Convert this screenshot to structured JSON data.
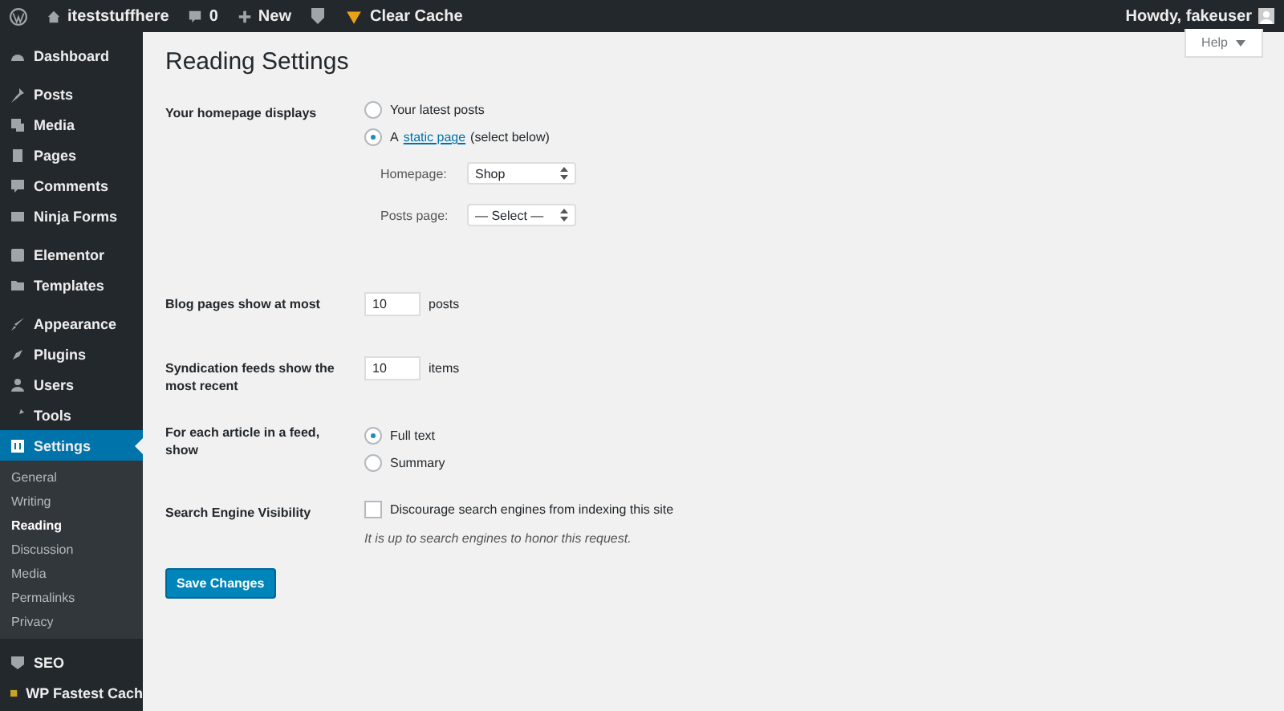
{
  "admin_bar": {
    "site": "iteststuffhere",
    "comments": "0",
    "new": "New",
    "cache": "Clear Cache",
    "greeting": "Howdy, fakeuser"
  },
  "sidebar": {
    "groups": [
      [
        {
          "label": "Dashboard",
          "selected": false
        }
      ],
      [
        {
          "label": "Posts",
          "selected": false
        },
        {
          "label": "Media",
          "selected": false
        },
        {
          "label": "Pages",
          "selected": false
        },
        {
          "label": "Comments",
          "selected": false
        },
        {
          "label": "Ninja Forms",
          "selected": false
        }
      ],
      [
        {
          "label": "Elementor",
          "selected": false
        },
        {
          "label": "Templates",
          "selected": false
        }
      ],
      [
        {
          "label": "Appearance",
          "selected": false
        },
        {
          "label": "Plugins",
          "selected": false
        },
        {
          "label": "Users",
          "selected": false
        },
        {
          "label": "Tools",
          "selected": false
        },
        {
          "label": "Settings",
          "selected": true,
          "children": [
            {
              "label": "General",
              "selected": false
            },
            {
              "label": "Writing",
              "selected": false
            },
            {
              "label": "Reading",
              "selected": true
            },
            {
              "label": "Discussion",
              "selected": false
            },
            {
              "label": "Media",
              "selected": false
            },
            {
              "label": "Permalinks",
              "selected": false
            },
            {
              "label": "Privacy",
              "selected": false
            }
          ]
        }
      ],
      [
        {
          "label": "SEO",
          "selected": false
        },
        {
          "label": "WP Fastest Cach",
          "selected": false
        }
      ]
    ]
  },
  "help": "Help",
  "title": "Reading Settings",
  "homepage": {
    "label": "Your homepage displays",
    "options": [
      {
        "text": "Your latest posts",
        "selected": false
      },
      {
        "text": "A",
        "link": "static page",
        "after": "(select below)",
        "selected": true
      }
    ],
    "selects": [
      {
        "label": "Homepage:",
        "value": "Shop"
      },
      {
        "label": "Posts page:",
        "value": "— Select —"
      }
    ]
  },
  "blog_pages": {
    "label": "Blog pages show at most",
    "value": "10",
    "unit": "posts"
  },
  "feeds": {
    "label": "Syndication feeds show the most recent",
    "value": "10",
    "unit": "items"
  },
  "feed_article": {
    "label": "For each article in a feed, show",
    "options": [
      {
        "text": "Full text",
        "selected": true
      },
      {
        "text": "Summary",
        "selected": false
      }
    ]
  },
  "visibility": {
    "label": "Search Engine Visibility",
    "checkbox": "Discourage search engines from indexing this site",
    "checked": false,
    "note": "It is up to search engines to honor this request."
  },
  "save": "Save Changes"
}
